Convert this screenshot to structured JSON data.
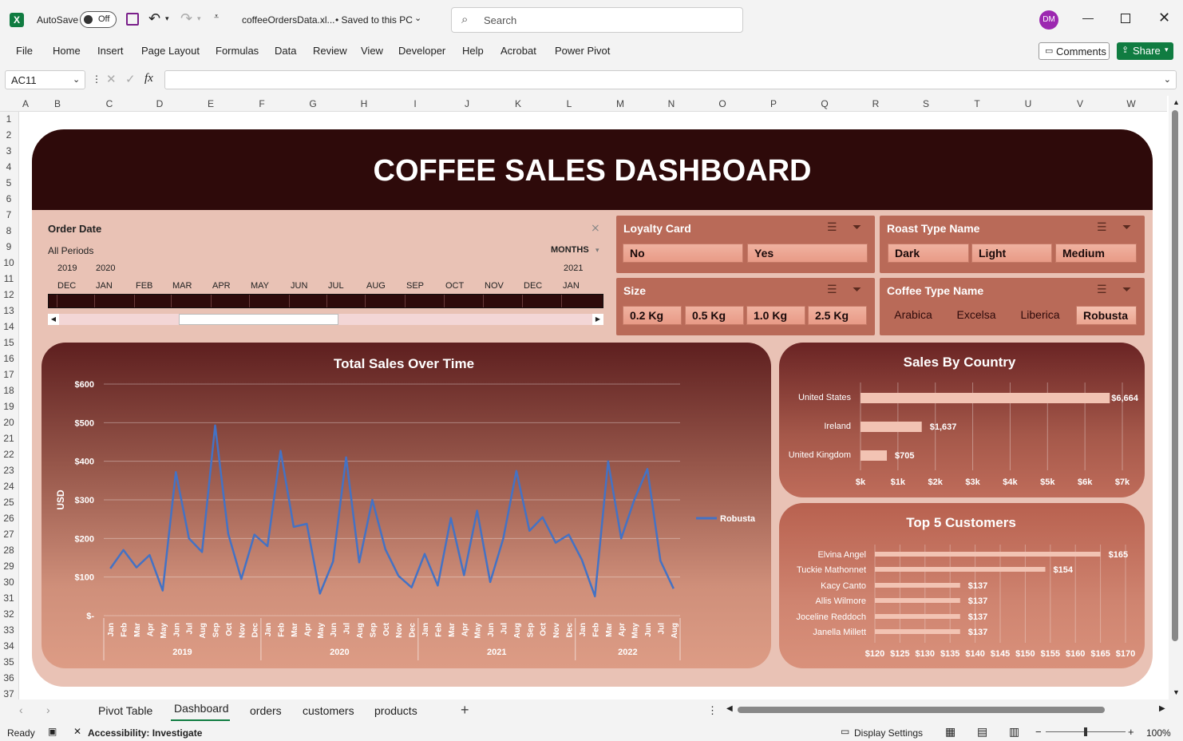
{
  "titlebar": {
    "autosave_label": "AutoSave",
    "autosave_state": "Off",
    "filename": "coffeeOrdersData.xl...",
    "saved_status": "• Saved to this PC",
    "search_placeholder": "Search",
    "avatar": "DM"
  },
  "ribbon": {
    "tabs": [
      "File",
      "Home",
      "Insert",
      "Page Layout",
      "Formulas",
      "Data",
      "Review",
      "View",
      "Developer",
      "Help",
      "Acrobat",
      "Power Pivot"
    ],
    "comments": "Comments",
    "share": "Share"
  },
  "formula_bar": {
    "name_box": "AC11",
    "fx": "fx",
    "value": ""
  },
  "columns": [
    "A",
    "B",
    "C",
    "D",
    "E",
    "F",
    "G",
    "H",
    "I",
    "J",
    "K",
    "L",
    "M",
    "N",
    "O",
    "P",
    "Q",
    "R",
    "S",
    "T",
    "U",
    "V",
    "W"
  ],
  "rows": [
    "1",
    "2",
    "3",
    "4",
    "5",
    "6",
    "7",
    "8",
    "9",
    "10",
    "11",
    "12",
    "13",
    "14",
    "15",
    "16",
    "17",
    "18",
    "19",
    "20",
    "21",
    "22",
    "23",
    "24",
    "25",
    "26",
    "27",
    "28",
    "29",
    "30",
    "31",
    "32",
    "33",
    "34",
    "35",
    "36",
    "37"
  ],
  "dashboard": {
    "title": "COFFEE SALES DASHBOARD",
    "colors": {
      "header": "#2e0a0a",
      "panel": "#e9c2b5",
      "slicer": "#b96a58",
      "line": "#4472c4"
    },
    "timeline": {
      "title": "Order Date",
      "period": "All Periods",
      "level": "MONTHS",
      "years": [
        "2019",
        "2020",
        "2021"
      ],
      "months": [
        "DEC",
        "JAN",
        "FEB",
        "MAR",
        "APR",
        "MAY",
        "JUN",
        "JUL",
        "AUG",
        "SEP",
        "OCT",
        "NOV",
        "DEC",
        "JAN"
      ]
    },
    "slicers": {
      "loyalty": {
        "title": "Loyalty Card",
        "items": [
          "No",
          "Yes"
        ]
      },
      "roast": {
        "title": "Roast Type Name",
        "items": [
          "Dark",
          "Light",
          "Medium"
        ]
      },
      "size": {
        "title": "Size",
        "items": [
          "0.2 Kg",
          "0.5 Kg",
          "1.0 Kg",
          "2.5 Kg"
        ]
      },
      "coffee": {
        "title": "Coffee Type Name",
        "items": [
          "Arabica",
          "Excelsa",
          "Liberica",
          "Robusta"
        ],
        "selected": "Robusta"
      }
    }
  },
  "chart_data": [
    {
      "type": "line",
      "title": "Total Sales Over Time",
      "ylabel": "USD",
      "ylim": [
        0,
        600
      ],
      "yticks": [
        "$-",
        "$100",
        "$200",
        "$300",
        "$400",
        "$500",
        "$600"
      ],
      "years": [
        "2019",
        "2020",
        "2021",
        "2022"
      ],
      "months": [
        "Jan",
        "Feb",
        "Mar",
        "Apr",
        "May",
        "Jun",
        "Jul",
        "Aug",
        "Sep",
        "Oct",
        "Nov",
        "Dec",
        "Jan",
        "Feb",
        "Mar",
        "Apr",
        "May",
        "Jun",
        "Jul",
        "Aug",
        "Sep",
        "Oct",
        "Nov",
        "Dec",
        "Jan",
        "Feb",
        "Mar",
        "Apr",
        "May",
        "Jun",
        "Jul",
        "Aug",
        "Sep",
        "Oct",
        "Nov",
        "Dec",
        "Jan",
        "Feb",
        "Mar",
        "Apr",
        "May",
        "Jun",
        "Jul",
        "Aug"
      ],
      "series": [
        {
          "name": "Robusta",
          "values": [
            122,
            170,
            125,
            157,
            65,
            372,
            200,
            165,
            493,
            212,
            95,
            210,
            180,
            427,
            230,
            238,
            57,
            140,
            410,
            138,
            300,
            172,
            103,
            73,
            160,
            78,
            253,
            105,
            272,
            87,
            200,
            375,
            220,
            255,
            189,
            210,
            145,
            50,
            400,
            200,
            300,
            380,
            142,
            70
          ]
        }
      ],
      "legend": "right"
    },
    {
      "type": "bar",
      "title": "Sales By Country",
      "categories": [
        "United States",
        "Ireland",
        "United Kingdom"
      ],
      "values": [
        6664,
        1637,
        705
      ],
      "labels": [
        "$6,664",
        "$1,637",
        "$705"
      ],
      "xlim": [
        0,
        7000
      ],
      "xticks": [
        "$k",
        "$1k",
        "$2k",
        "$3k",
        "$4k",
        "$5k",
        "$6k",
        "$7k"
      ]
    },
    {
      "type": "bar",
      "title": "Top 5 Customers",
      "categories": [
        "Elvina Angel",
        "Tuckie Mathonnet",
        "Kacy Canto",
        "Allis Wilmore",
        "Joceline Reddoch",
        "Janella Millett"
      ],
      "values": [
        165,
        154,
        137,
        137,
        137,
        137
      ],
      "labels": [
        "$165",
        "$154",
        "$137",
        "$137",
        "$137",
        "$137"
      ],
      "xlim": [
        120,
        170
      ],
      "xticks": [
        "$120",
        "$125",
        "$130",
        "$135",
        "$140",
        "$145",
        "$150",
        "$155",
        "$160",
        "$165",
        "$170"
      ]
    }
  ],
  "sheets": {
    "tabs": [
      "Pivot Table",
      "Dashboard",
      "orders",
      "customers",
      "products"
    ],
    "active": "Dashboard"
  },
  "status": {
    "ready": "Ready",
    "accessibility": "Accessibility: Investigate",
    "display": "Display Settings",
    "zoom": "100%"
  }
}
